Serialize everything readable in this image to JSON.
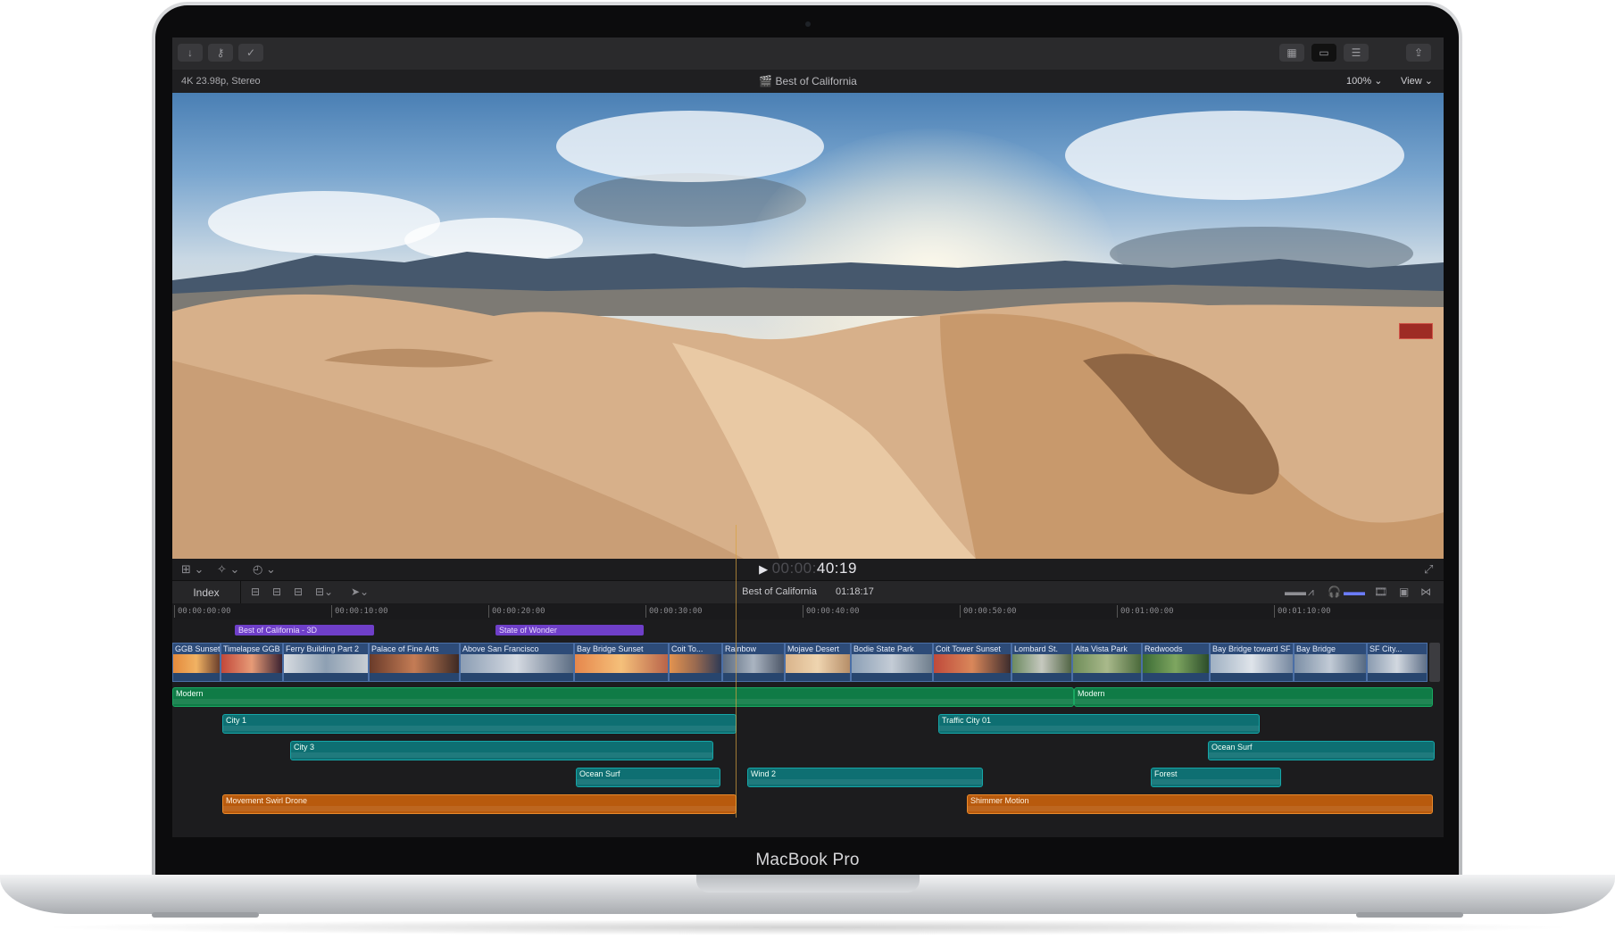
{
  "device": {
    "brand": "MacBook Pro"
  },
  "toolbar": {
    "left_buttons": [
      {
        "name": "import-icon",
        "glyph": "↓"
      },
      {
        "name": "keywords-icon",
        "glyph": "⚷"
      },
      {
        "name": "background-tasks-icon",
        "glyph": "✓"
      }
    ],
    "right_buttons": [
      {
        "name": "browser-icon",
        "glyph": "▦"
      },
      {
        "name": "timeline-icon",
        "glyph": "▭"
      },
      {
        "name": "inspector-icon",
        "glyph": "☰"
      },
      {
        "name": "share-icon",
        "glyph": "⇪"
      }
    ]
  },
  "viewer": {
    "format": "4K 23.98p, Stereo",
    "project_title": "Best of California",
    "zoom": "100% ⌄",
    "view_label": "View ⌄"
  },
  "transport": {
    "timecode_dim": "00:00:",
    "timecode_bright": "40:19",
    "play_glyph": "▶"
  },
  "timeline": {
    "index_label": "Index",
    "project_name": "Best of California",
    "duration": "01:18:17",
    "ruler": [
      "00:00:00:00",
      "00:00:10:00",
      "00:00:20:00",
      "00:00:30:00",
      "00:00:40:00",
      "00:00:50:00",
      "00:01:00:00",
      "00:01:10:00"
    ],
    "titles": [
      "Best of California - 3D",
      "State of Wonder"
    ],
    "clips": [
      "GGB Sunset",
      "Timelapse GGB",
      "Ferry Building Part 2",
      "Palace of Fine Arts",
      "Above San Francisco",
      "Bay Bridge Sunset",
      "Coit To...",
      "Rainbow",
      "Mojave Desert",
      "Bodie State Park",
      "Coit Tower Sunset",
      "Lombard St.",
      "Alta Vista Park",
      "Redwoods",
      "Bay Bridge toward SF",
      "Bay Bridge",
      "SF City..."
    ],
    "audio": {
      "music": [
        "Modern",
        "Modern"
      ],
      "teal": [
        "City 1",
        "Traffic City 01",
        "City 3",
        "Ocean Surf",
        "Ocean Surf",
        "Wind 2",
        "Forest"
      ],
      "orange": [
        "Movement Swirl Drone",
        "Shimmer Motion"
      ]
    }
  },
  "colors": {
    "title_purple": "#6f3fc9",
    "clip_blue": "#2d4b78",
    "audio_green": "#0f7b46",
    "audio_teal": "#0e6f72",
    "audio_orange": "#b85a0d",
    "playhead": "#d9a23e"
  }
}
